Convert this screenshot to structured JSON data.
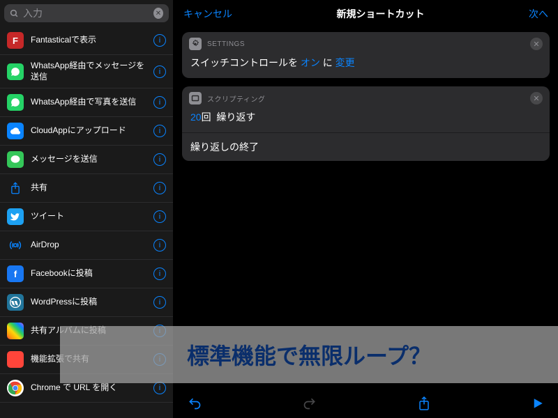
{
  "search": {
    "value": "入力"
  },
  "sidebar": {
    "items": [
      {
        "label": "Fantasticalで表示"
      },
      {
        "label": "WhatsApp経由でメッセージを送信"
      },
      {
        "label": "WhatsApp経由で写真を送信"
      },
      {
        "label": "CloudAppにアップロード"
      },
      {
        "label": "メッセージを送信"
      },
      {
        "label": "共有"
      },
      {
        "label": "ツイート"
      },
      {
        "label": "AirDrop"
      },
      {
        "label": "Facebookに投稿"
      },
      {
        "label": "WordPressに投稿"
      },
      {
        "label": "共有アルバムに投稿"
      },
      {
        "label": "機能拡張で共有"
      },
      {
        "label": "Chrome で URL を開く"
      }
    ]
  },
  "topbar": {
    "cancel": "キャンセル",
    "title": "新規ショートカット",
    "next": "次へ"
  },
  "cards": {
    "settings": {
      "header": "SETTINGS",
      "prefix": "スイッチコントロールを",
      "value": "オン",
      "middle": "に",
      "action": "変更"
    },
    "scripting": {
      "header": "スクリプティング",
      "count": "20",
      "unit": "回",
      "action": "繰り返す",
      "end": "繰り返しの終了"
    }
  },
  "overlay": {
    "text": "標準機能で無限ループ？"
  }
}
